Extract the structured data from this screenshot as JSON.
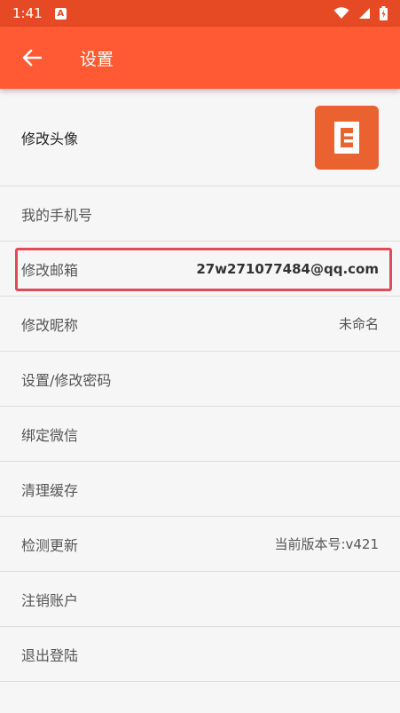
{
  "status_bar": {
    "time": "1:41",
    "notification_badge": "A"
  },
  "app_bar": {
    "title": "设置"
  },
  "list": {
    "avatar_label": "修改头像",
    "phone_label": "我的手机号",
    "email_label": "修改邮箱",
    "email_value": "27w271077484@qq.com",
    "nickname_label": "修改昵称",
    "nickname_value": "未命名",
    "password_label": "设置/修改密码",
    "wechat_label": "绑定微信",
    "cache_label": "清理缓存",
    "update_label": "检测更新",
    "update_value": "当前版本号:v421",
    "cancel_account_label": "注销账户",
    "logout_label": "退出登陆"
  },
  "colors": {
    "status_bar": "#e64a24",
    "app_bar": "#ff5a33",
    "highlight_border": "#e24a5c",
    "avatar_bg": "#e9622f"
  },
  "icons": [
    "back-arrow-icon",
    "wifi-icon",
    "signal-icon",
    "battery-icon",
    "app-logo-icon"
  ]
}
